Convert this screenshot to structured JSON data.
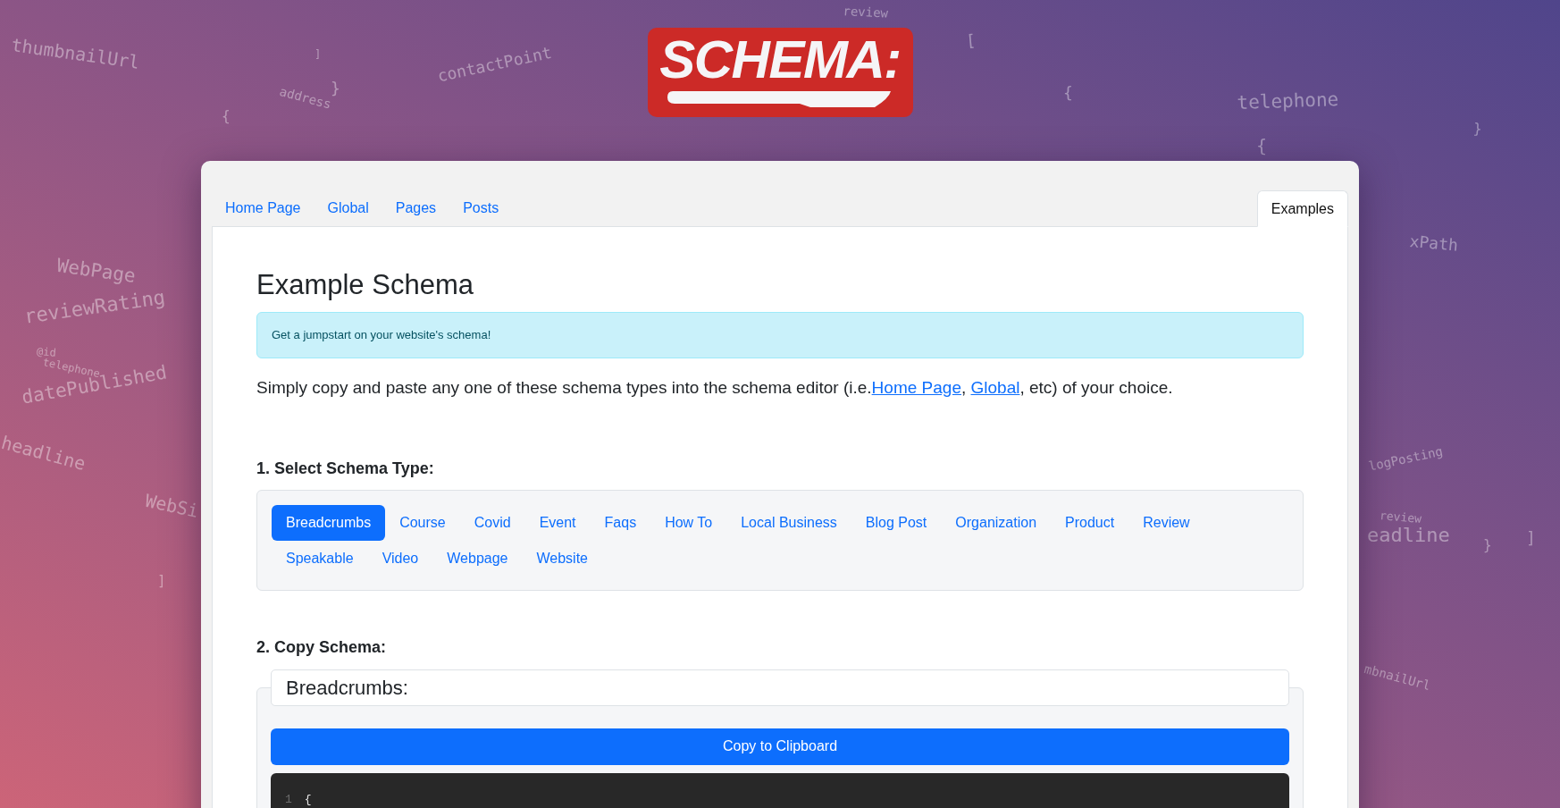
{
  "background_words": [
    {
      "text": "thumbnailUrl"
    },
    {
      "text": "address"
    },
    {
      "text": "contactPoint"
    },
    {
      "text": "review"
    },
    {
      "text": "telephone"
    },
    {
      "text": "xPath"
    },
    {
      "text": "WebPage"
    },
    {
      "text": "reviewRating"
    },
    {
      "text": "@id"
    },
    {
      "text": "telephone"
    },
    {
      "text": "datePublished"
    },
    {
      "text": "headline"
    },
    {
      "text": "WebSi"
    },
    {
      "text": "logPosting"
    },
    {
      "text": "review"
    },
    {
      "text": "eadline"
    },
    {
      "text": "mbnailUrl"
    },
    {
      "text": "{"
    },
    {
      "text": "}"
    },
    {
      "text": "["
    },
    {
      "text": "]"
    },
    {
      "text": "{"
    },
    {
      "text": "}"
    },
    {
      "text": "{"
    },
    {
      "text": "]"
    },
    {
      "text": "]"
    },
    {
      "text": "}"
    }
  ],
  "logo": {
    "text": "SCHEMA:"
  },
  "tabs": [
    {
      "label": "Home Page",
      "selected": false
    },
    {
      "label": "Global",
      "selected": false
    },
    {
      "label": "Pages",
      "selected": false
    },
    {
      "label": "Posts",
      "selected": false
    },
    {
      "label": "Examples",
      "selected": true
    }
  ],
  "heading": "Example Schema",
  "alert": "Get a jumpstart on your website's schema!",
  "intro": [
    {
      "kind": "text",
      "text": "Simply copy and paste any one of these schema types into the schema editor (i.e."
    },
    {
      "kind": "link",
      "text": "Home Page"
    },
    {
      "kind": "text",
      "text": ", "
    },
    {
      "kind": "link",
      "text": "Global"
    },
    {
      "kind": "text",
      "text": ", etc) of your choice."
    }
  ],
  "step1": "1. Select Schema Type:",
  "schema_types": [
    {
      "label": "Breadcrumbs",
      "selected": true
    },
    {
      "label": "Course",
      "selected": false
    },
    {
      "label": "Covid",
      "selected": false
    },
    {
      "label": "Event",
      "selected": false
    },
    {
      "label": "Faqs",
      "selected": false
    },
    {
      "label": "How To",
      "selected": false
    },
    {
      "label": "Local Business",
      "selected": false
    },
    {
      "label": "Blog Post",
      "selected": false
    },
    {
      "label": "Organization",
      "selected": false
    },
    {
      "label": "Product",
      "selected": false
    },
    {
      "label": "Review",
      "selected": false
    },
    {
      "label": "Speakable",
      "selected": false
    },
    {
      "label": "Video",
      "selected": false
    },
    {
      "label": "Webpage",
      "selected": false
    },
    {
      "label": "Website",
      "selected": false
    }
  ],
  "step2": "2. Copy Schema:",
  "schema_title": "Breadcrumbs:",
  "copy_button": "Copy to Clipboard",
  "code": {
    "lines": [
      {
        "number": "1",
        "text": "{"
      }
    ]
  }
}
